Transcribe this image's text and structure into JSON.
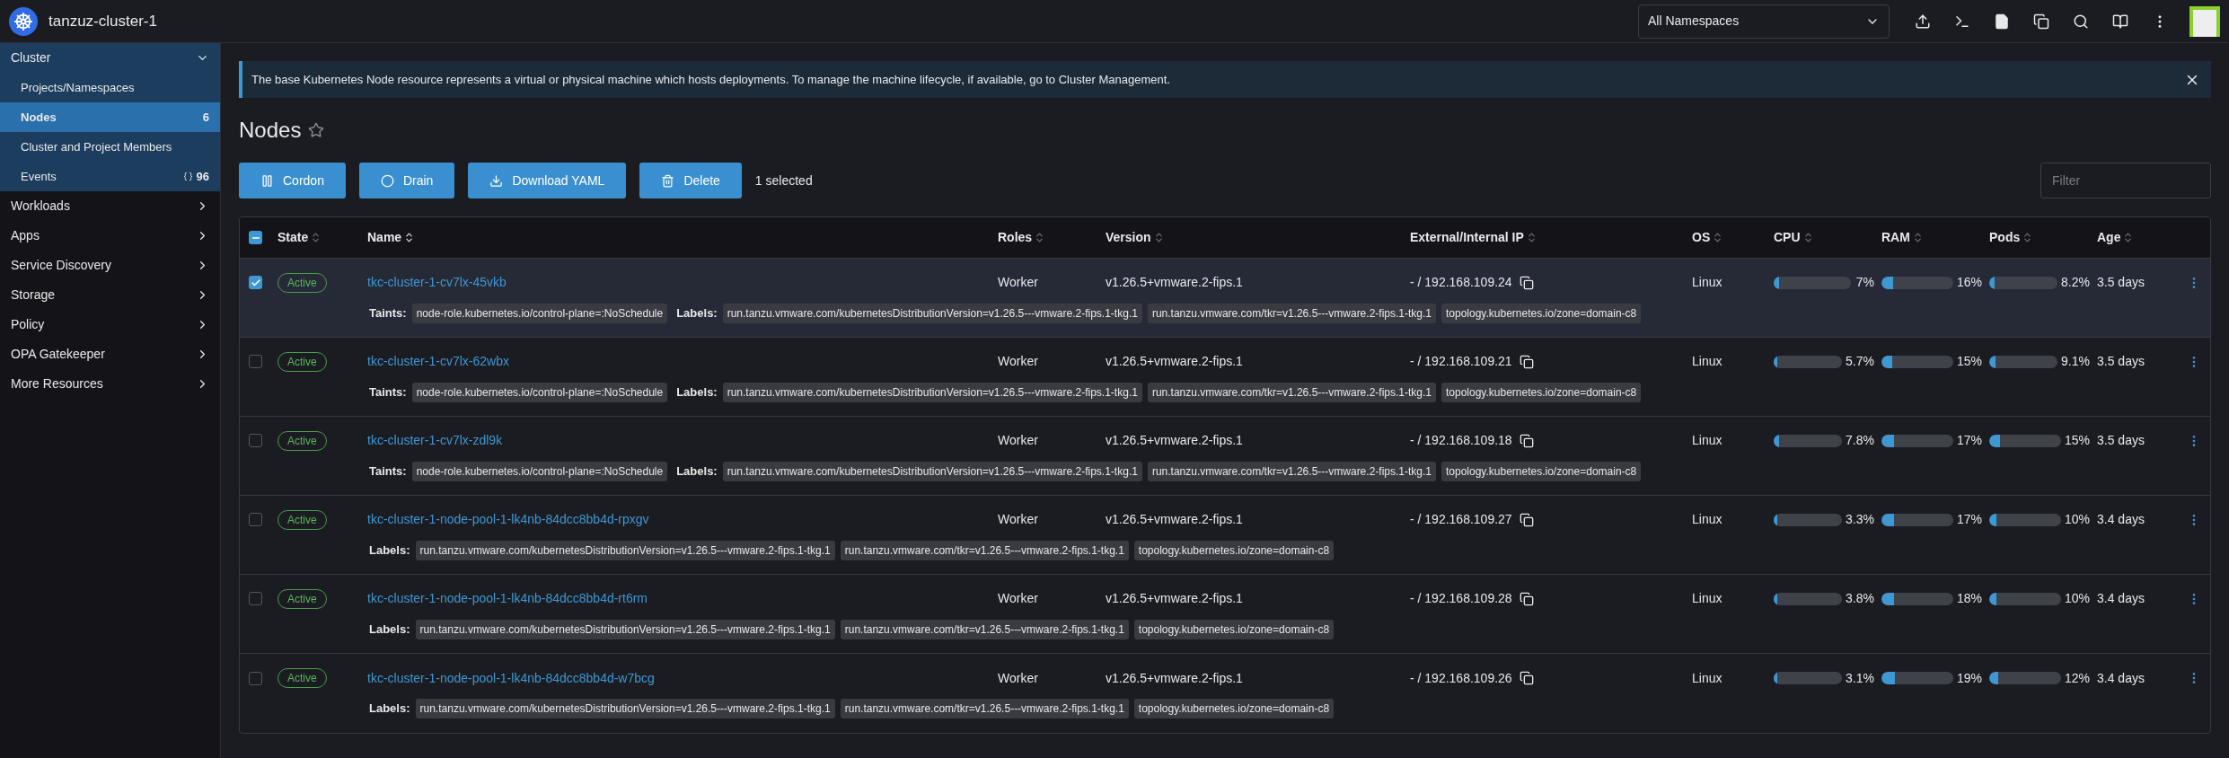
{
  "header": {
    "title": "tanzuz-cluster-1",
    "namespace_select": {
      "value": "All Namespaces"
    }
  },
  "sidebar": {
    "groups": [
      {
        "label": "Cluster",
        "expanded": true,
        "items": [
          {
            "label": "Projects/Namespaces",
            "selected": false
          },
          {
            "label": "Nodes",
            "count": "6",
            "selected": true
          },
          {
            "label": "Cluster and Project Members",
            "selected": false
          },
          {
            "label": "Events",
            "count": "96",
            "selected": false,
            "kind": "events"
          }
        ]
      },
      {
        "label": "Workloads",
        "expanded": false
      },
      {
        "label": "Apps",
        "expanded": false
      },
      {
        "label": "Service Discovery",
        "expanded": false
      },
      {
        "label": "Storage",
        "expanded": false
      },
      {
        "label": "Policy",
        "expanded": false
      },
      {
        "label": "OPA Gatekeeper",
        "expanded": false
      },
      {
        "label": "More Resources",
        "expanded": false
      }
    ]
  },
  "banner": {
    "text": "The base Kubernetes Node resource represents a virtual or physical machine which hosts deployments. To manage the machine lifecycle, if available, go to Cluster Management."
  },
  "page_title": "Nodes",
  "actions": [
    {
      "label": "Cordon",
      "kind": "pause"
    },
    {
      "label": "Drain",
      "kind": "circle"
    },
    {
      "label": "Download YAML",
      "kind": "download"
    },
    {
      "label": "Delete",
      "kind": "delete"
    }
  ],
  "selection_count": "1 selected",
  "filter": {
    "placeholder": "Filter"
  },
  "table": {
    "select_all_partial": true,
    "columns": [
      {
        "label": "State",
        "sorted": false
      },
      {
        "label": "Name",
        "sorted": true
      },
      {
        "label": "Roles",
        "sorted": false
      },
      {
        "label": "Version",
        "sorted": false
      },
      {
        "label": "External/Internal IP",
        "sorted": false
      },
      {
        "label": "OS",
        "sorted": false
      },
      {
        "label": "CPU",
        "sorted": false
      },
      {
        "label": "RAM",
        "sorted": false
      },
      {
        "label": "Pods",
        "sorted": false
      },
      {
        "label": "Age",
        "sorted": false
      }
    ],
    "rows": [
      {
        "selected": true,
        "state": "Active",
        "name": "tkc-cluster-1-cv7lx-45vkb",
        "roles": "Worker",
        "version": "v1.26.5+vmware.2-fips.1",
        "ip": "- / 192.168.109.24",
        "os": "Linux",
        "cpu": {
          "level": 0.07,
          "reading": "7%"
        },
        "ram": {
          "level": 0.16,
          "reading": "16%"
        },
        "pods": {
          "level": 0.082,
          "reading": "8.2%"
        },
        "age": "3.5 days",
        "taints": {
          "label": "Taints:",
          "items": [
            "node-role.kubernetes.io/control-plane=:NoSchedule"
          ]
        },
        "labels": {
          "label": "Labels:",
          "items": [
            "run.tanzu.vmware.com/kubernetesDistributionVersion=v1.26.5---vmware.2-fips.1-tkg.1",
            "run.tanzu.vmware.com/tkr=v1.26.5---vmware.2-fips.1-tkg.1",
            "topology.kubernetes.io/zone=domain-c8"
          ]
        }
      },
      {
        "selected": false,
        "state": "Active",
        "name": "tkc-cluster-1-cv7lx-62wbx",
        "roles": "Worker",
        "version": "v1.26.5+vmware.2-fips.1",
        "ip": "- / 192.168.109.21",
        "os": "Linux",
        "cpu": {
          "level": 0.057,
          "reading": "5.7%"
        },
        "ram": {
          "level": 0.15,
          "reading": "15%"
        },
        "pods": {
          "level": 0.091,
          "reading": "9.1%"
        },
        "age": "3.5 days",
        "taints": {
          "label": "Taints:",
          "items": [
            "node-role.kubernetes.io/control-plane=:NoSchedule"
          ]
        },
        "labels": {
          "label": "Labels:",
          "items": [
            "run.tanzu.vmware.com/kubernetesDistributionVersion=v1.26.5---vmware.2-fips.1-tkg.1",
            "run.tanzu.vmware.com/tkr=v1.26.5---vmware.2-fips.1-tkg.1",
            "topology.kubernetes.io/zone=domain-c8"
          ]
        }
      },
      {
        "selected": false,
        "state": "Active",
        "name": "tkc-cluster-1-cv7lx-zdl9k",
        "roles": "Worker",
        "version": "v1.26.5+vmware.2-fips.1",
        "ip": "- / 192.168.109.18",
        "os": "Linux",
        "cpu": {
          "level": 0.078,
          "reading": "7.8%"
        },
        "ram": {
          "level": 0.17,
          "reading": "17%"
        },
        "pods": {
          "level": 0.15,
          "reading": "15%"
        },
        "age": "3.5 days",
        "taints": {
          "label": "Taints:",
          "items": [
            "node-role.kubernetes.io/control-plane=:NoSchedule"
          ]
        },
        "labels": {
          "label": "Labels:",
          "items": [
            "run.tanzu.vmware.com/kubernetesDistributionVersion=v1.26.5---vmware.2-fips.1-tkg.1",
            "run.tanzu.vmware.com/tkr=v1.26.5---vmware.2-fips.1-tkg.1",
            "topology.kubernetes.io/zone=domain-c8"
          ]
        }
      },
      {
        "selected": false,
        "state": "Active",
        "name": "tkc-cluster-1-node-pool-1-lk4nb-84dcc8bb4d-rpxgv",
        "roles": "Worker",
        "version": "v1.26.5+vmware.2-fips.1",
        "ip": "- / 192.168.109.27",
        "os": "Linux",
        "cpu": {
          "level": 0.033,
          "reading": "3.3%"
        },
        "ram": {
          "level": 0.17,
          "reading": "17%"
        },
        "pods": {
          "level": 0.1,
          "reading": "10%"
        },
        "age": "3.4 days",
        "labels": {
          "label": "Labels:",
          "items": [
            "run.tanzu.vmware.com/kubernetesDistributionVersion=v1.26.5---vmware.2-fips.1-tkg.1",
            "run.tanzu.vmware.com/tkr=v1.26.5---vmware.2-fips.1-tkg.1",
            "topology.kubernetes.io/zone=domain-c8"
          ]
        }
      },
      {
        "selected": false,
        "state": "Active",
        "name": "tkc-cluster-1-node-pool-1-lk4nb-84dcc8bb4d-rt6rm",
        "roles": "Worker",
        "version": "v1.26.5+vmware.2-fips.1",
        "ip": "- / 192.168.109.28",
        "os": "Linux",
        "cpu": {
          "level": 0.038,
          "reading": "3.8%"
        },
        "ram": {
          "level": 0.18,
          "reading": "18%"
        },
        "pods": {
          "level": 0.1,
          "reading": "10%"
        },
        "age": "3.4 days",
        "labels": {
          "label": "Labels:",
          "items": [
            "run.tanzu.vmware.com/kubernetesDistributionVersion=v1.26.5---vmware.2-fips.1-tkg.1",
            "run.tanzu.vmware.com/tkr=v1.26.5---vmware.2-fips.1-tkg.1",
            "topology.kubernetes.io/zone=domain-c8"
          ]
        }
      },
      {
        "selected": false,
        "state": "Active",
        "name": "tkc-cluster-1-node-pool-1-lk4nb-84dcc8bb4d-w7bcg",
        "roles": "Worker",
        "version": "v1.26.5+vmware.2-fips.1",
        "ip": "- / 192.168.109.26",
        "os": "Linux",
        "cpu": {
          "level": 0.031,
          "reading": "3.1%"
        },
        "ram": {
          "level": 0.19,
          "reading": "19%"
        },
        "pods": {
          "level": 0.12,
          "reading": "12%"
        },
        "age": "3.4 days",
        "labels": {
          "label": "Labels:",
          "items": [
            "run.tanzu.vmware.com/kubernetesDistributionVersion=v1.26.5---vmware.2-fips.1-tkg.1",
            "run.tanzu.vmware.com/tkr=v1.26.5---vmware.2-fips.1-tkg.1",
            "topology.kubernetes.io/zone=domain-c8"
          ]
        }
      }
    ]
  }
}
